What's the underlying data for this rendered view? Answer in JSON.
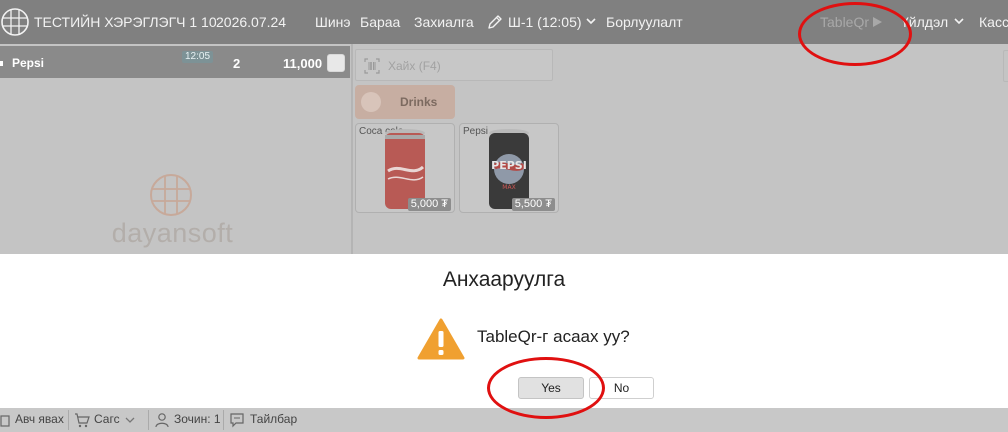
{
  "header": {
    "app_title": "ТЕСТИЙН ХЭРЭГЛЭГЧ 1 10",
    "date": "2026.07.24",
    "menu": {
      "new": "Шинэ",
      "products": "Бараа",
      "orders": "Захиалга",
      "table": "Ш-1 (12:05)",
      "sales": "Борлуулалт",
      "tableqr": "TableQr",
      "service": "Үйлдэл",
      "cashier": "Касс"
    }
  },
  "order": {
    "item_name": "Pepsi",
    "time": "12:05",
    "quantity": "2",
    "amount": "11,000"
  },
  "watermark": {
    "brand": "dayansoft"
  },
  "catalog": {
    "search_placeholder": "Хайх (F4)",
    "category": "Drinks",
    "products": [
      {
        "name": "Coca cola",
        "price": "5,000 ₮"
      },
      {
        "name": "Pepsi",
        "price": "5,500 ₮"
      }
    ]
  },
  "dialog": {
    "title": "Анхааруулга",
    "message": "TableQr-г асаах уу?",
    "yes": "Yes",
    "no": "No"
  },
  "footer": {
    "takeaway": "Авч явах",
    "cart": "Сагс",
    "guests": "Зочин: 1",
    "note": "Тайлбар"
  },
  "colors": {
    "annotation": "#e01010",
    "warning": "#f0a030",
    "brand_accent": "#e8a080"
  }
}
